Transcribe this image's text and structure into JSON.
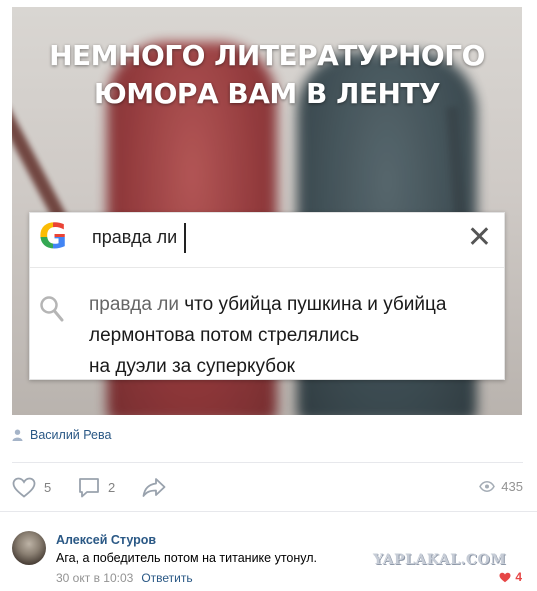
{
  "post": {
    "image": {
      "caption_line1": "НЕМНОГО ЛИТЕРАТУРНОГО",
      "caption_line2": "ЮМОРА ВАМ В ЛЕНТУ",
      "search": {
        "logo": "G",
        "query": "правда ли",
        "close_glyph": "✕",
        "suggestion_prefix": "правда ли",
        "suggestion_line1_rest": "что убийца пушкина и убийца",
        "suggestion_line2": "лермонтова потом стрелялись",
        "suggestion_line3": "на дуэли за суперкубок"
      }
    },
    "author": "Василий Рева",
    "actions": {
      "likes": "5",
      "comments": "2",
      "views": "435"
    },
    "icons": [
      "user-icon",
      "heart-icon",
      "comment-icon",
      "share-icon",
      "eye-icon",
      "search-icon",
      "close-icon"
    ]
  },
  "comment": {
    "author": "Алексей Стуров",
    "text": "Ага, а победитель потом на титанике утонул.",
    "date": "30 окт в 10:03",
    "reply_label": "Ответить",
    "likes": "4"
  },
  "watermark": "YAPLAKAL.COM",
  "colors": {
    "link": "#2a5885",
    "muted": "#828282",
    "like_red": "#e64646",
    "divider": "#e7e8ec"
  }
}
